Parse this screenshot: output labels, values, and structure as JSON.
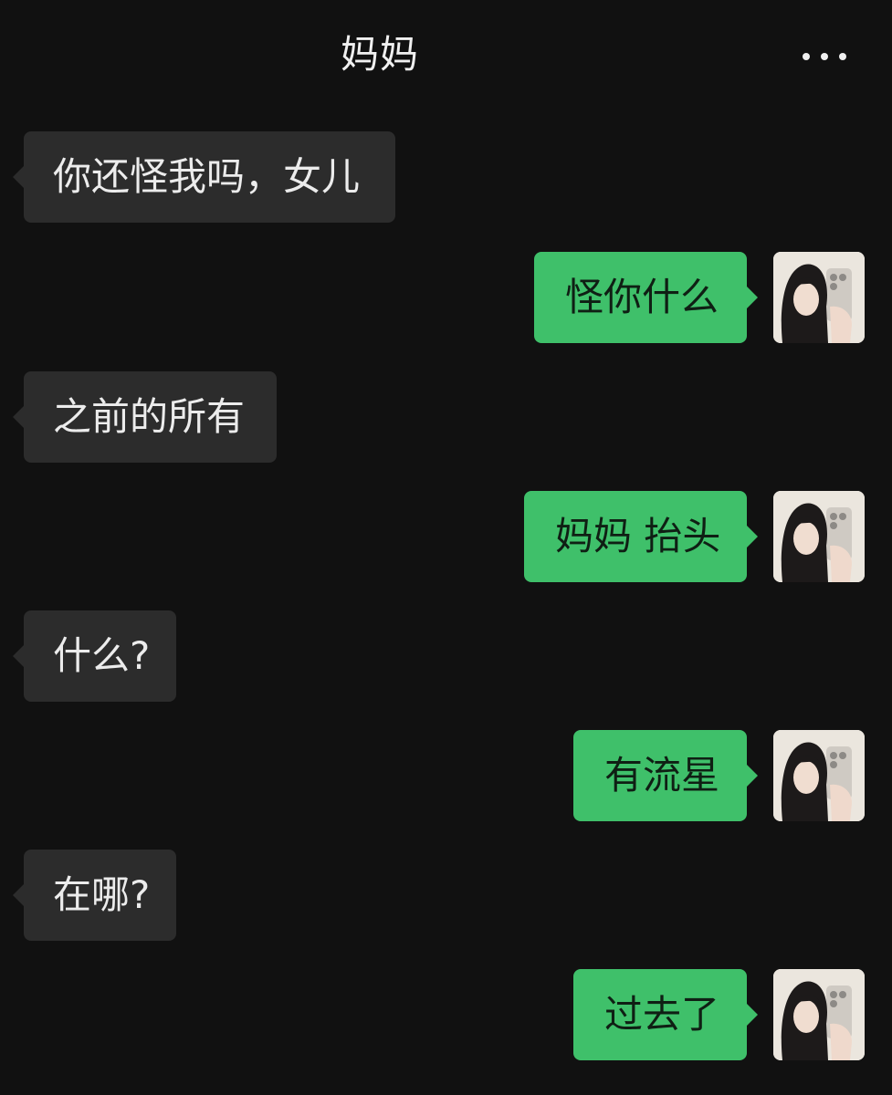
{
  "header": {
    "title": "妈妈",
    "menu_icon": "more-dots-icon"
  },
  "messages": [
    {
      "side": "in",
      "text": "你还怪我吗，女儿"
    },
    {
      "side": "out",
      "text": "怪你什么"
    },
    {
      "side": "in",
      "text": "之前的所有"
    },
    {
      "side": "out",
      "text": "妈妈 抬头"
    },
    {
      "side": "in",
      "text": "什么?"
    },
    {
      "side": "out",
      "text": "有流星"
    },
    {
      "side": "in",
      "text": "在哪?"
    },
    {
      "side": "out",
      "text": "过去了"
    }
  ],
  "colors": {
    "background": "#111111",
    "incoming_bubble": "#2c2c2c",
    "outgoing_bubble": "#3fc06a"
  }
}
